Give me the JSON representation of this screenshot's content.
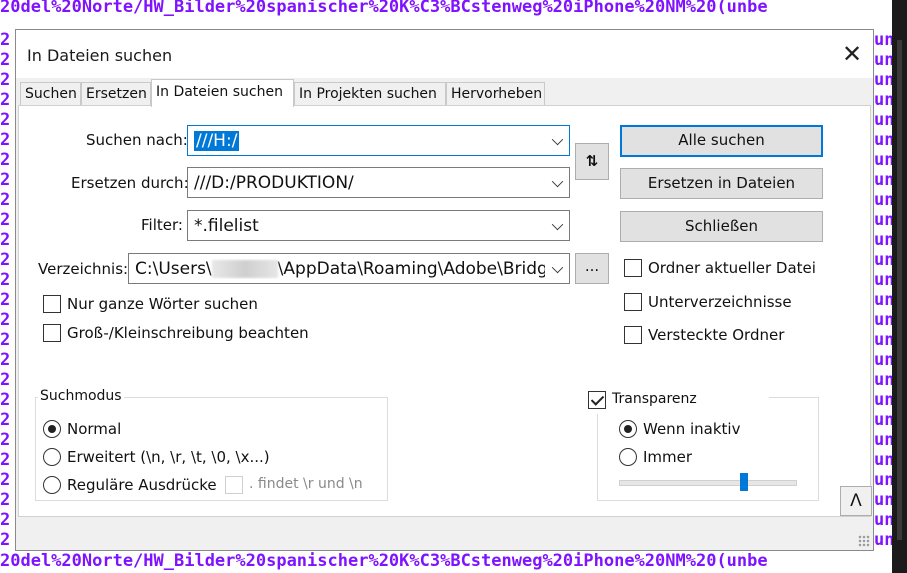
{
  "background": {
    "editor_line": "20del%20Norte/HW_Bilder%20spanischer%20K%C3%BCstenweg%20iPhone%20NM%20(unbe",
    "right_fragment": "unbe",
    "left_fragment": "2"
  },
  "dialog": {
    "title": "In Dateien suchen",
    "close_label": "✕"
  },
  "tabs": [
    {
      "label": "Suchen"
    },
    {
      "label": "Ersetzen"
    },
    {
      "label": "In Dateien suchen"
    },
    {
      "label": "In Projekten suchen"
    },
    {
      "label": "Hervorheben"
    }
  ],
  "form": {
    "search_label": "Suchen nach:",
    "search_value": "///H:/",
    "replace_label": "Ersetzen durch:",
    "replace_value": "///D:/PRODUKTION/",
    "filter_label": "Filter:",
    "filter_value": "*.filelist",
    "directory_label": "Verzeichnis:",
    "directory_value_prefix": "C:\\Users\\",
    "directory_value_suffix": "\\AppData\\Roaming\\Adobe\\Bridg",
    "browse_label": "..."
  },
  "buttons": {
    "swap_label": "⇅",
    "find_all": "Alle suchen",
    "replace_in_files": "Ersetzen in Dateien",
    "close": "Schließen"
  },
  "options": {
    "whole_word": "Nur ganze Wörter suchen",
    "match_case": "Groß-/Kleinschreibung beachten",
    "current_folder": "Ordner aktueller Datei",
    "subfolders": "Unterverzeichnisse",
    "hidden_folders": "Versteckte Ordner"
  },
  "search_mode": {
    "title": "Suchmodus",
    "normal": "Normal",
    "extended": "Erweitert (\\n, \\r, \\t, \\0, \\x...)",
    "regex": "Reguläre Ausdrücke",
    "dot_matches": ". findet \\r und \\n"
  },
  "transparency": {
    "title": "Transparenz",
    "checked": true,
    "on_inactive": "Wenn inaktiv",
    "always": "Immer",
    "level": 0.72
  },
  "misc": {
    "up_arrow": "Λ"
  },
  "colors": {
    "accent": "#0078d7",
    "background_text": "#7f12ff"
  }
}
